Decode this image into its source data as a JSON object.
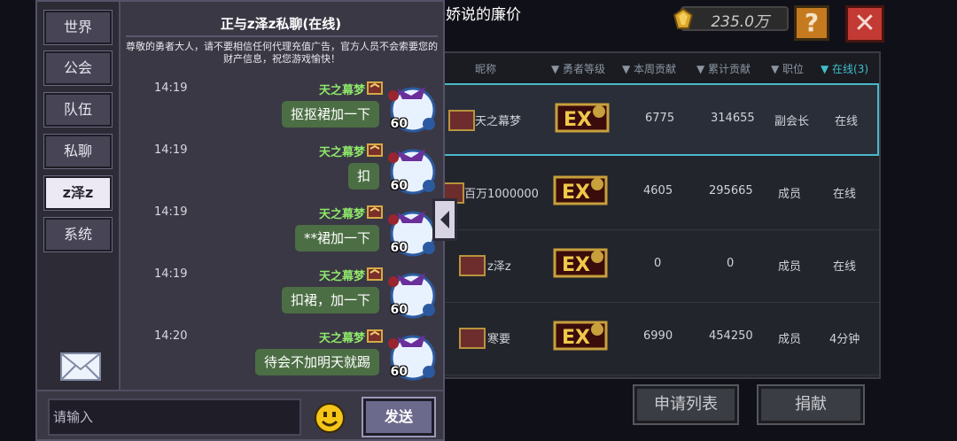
{
  "marquee": "美娇说的廉价",
  "gold": {
    "amount": "235.0万"
  },
  "header_buttons": {
    "help": "?",
    "close": "✕"
  },
  "guild_table": {
    "columns": [
      "昵称",
      "勇者等级",
      "本周贡献",
      "累计贡献",
      "职位",
      "在线(3)"
    ],
    "rows": [
      {
        "name": "天之幕梦",
        "weekly": "6775",
        "total": "314655",
        "position": "副会长",
        "status": "在线"
      },
      {
        "name": "百万1000000",
        "weekly": "4605",
        "total": "295665",
        "position": "成员",
        "status": "在线"
      },
      {
        "name": "z泽z",
        "weekly": "0",
        "total": "0",
        "position": "成员",
        "status": "在线"
      },
      {
        "name": "寒要",
        "weekly": "6990",
        "total": "454250",
        "position": "成员",
        "status": "4分钟"
      }
    ],
    "apply_list_label": "申请列表",
    "donate_label": "捐献"
  },
  "chat": {
    "tabs": [
      "世界",
      "公会",
      "队伍",
      "私聊",
      "z泽z",
      "系统"
    ],
    "active_tab": "z泽z",
    "title": "正与z泽z私聊(在线)",
    "notice": "尊敬的勇者大人，请不要相信任何代理充值广告，官方人员不会索要您的财产信息，祝您游戏愉快！",
    "messages": [
      {
        "time": "14:19",
        "sender": "天之幕梦",
        "text": "抠抠裙加一下",
        "level": "60"
      },
      {
        "time": "14:19",
        "sender": "天之幕梦",
        "text": "扣",
        "level": "60"
      },
      {
        "time": "14:19",
        "sender": "天之幕梦",
        "text": "**裙加一下",
        "level": "60"
      },
      {
        "time": "14:19",
        "sender": "天之幕梦",
        "text": "扣裙，加一下",
        "level": "60"
      },
      {
        "time": "14:20",
        "sender": "天之幕梦",
        "text": "待会不加明天就踢",
        "level": "60"
      }
    ],
    "input_placeholder": "请输入",
    "send_label": "发送"
  },
  "icons": [
    "gold-icon",
    "mail-icon",
    "emoji-icon",
    "collapse-arrow-icon",
    "rank-badge-icon",
    "avatar-icon"
  ],
  "colors": {
    "bubble": "#4c6e44",
    "sender_name": "#8fe86a",
    "accent": "#4ab8c8",
    "panel": "#3a3844"
  }
}
